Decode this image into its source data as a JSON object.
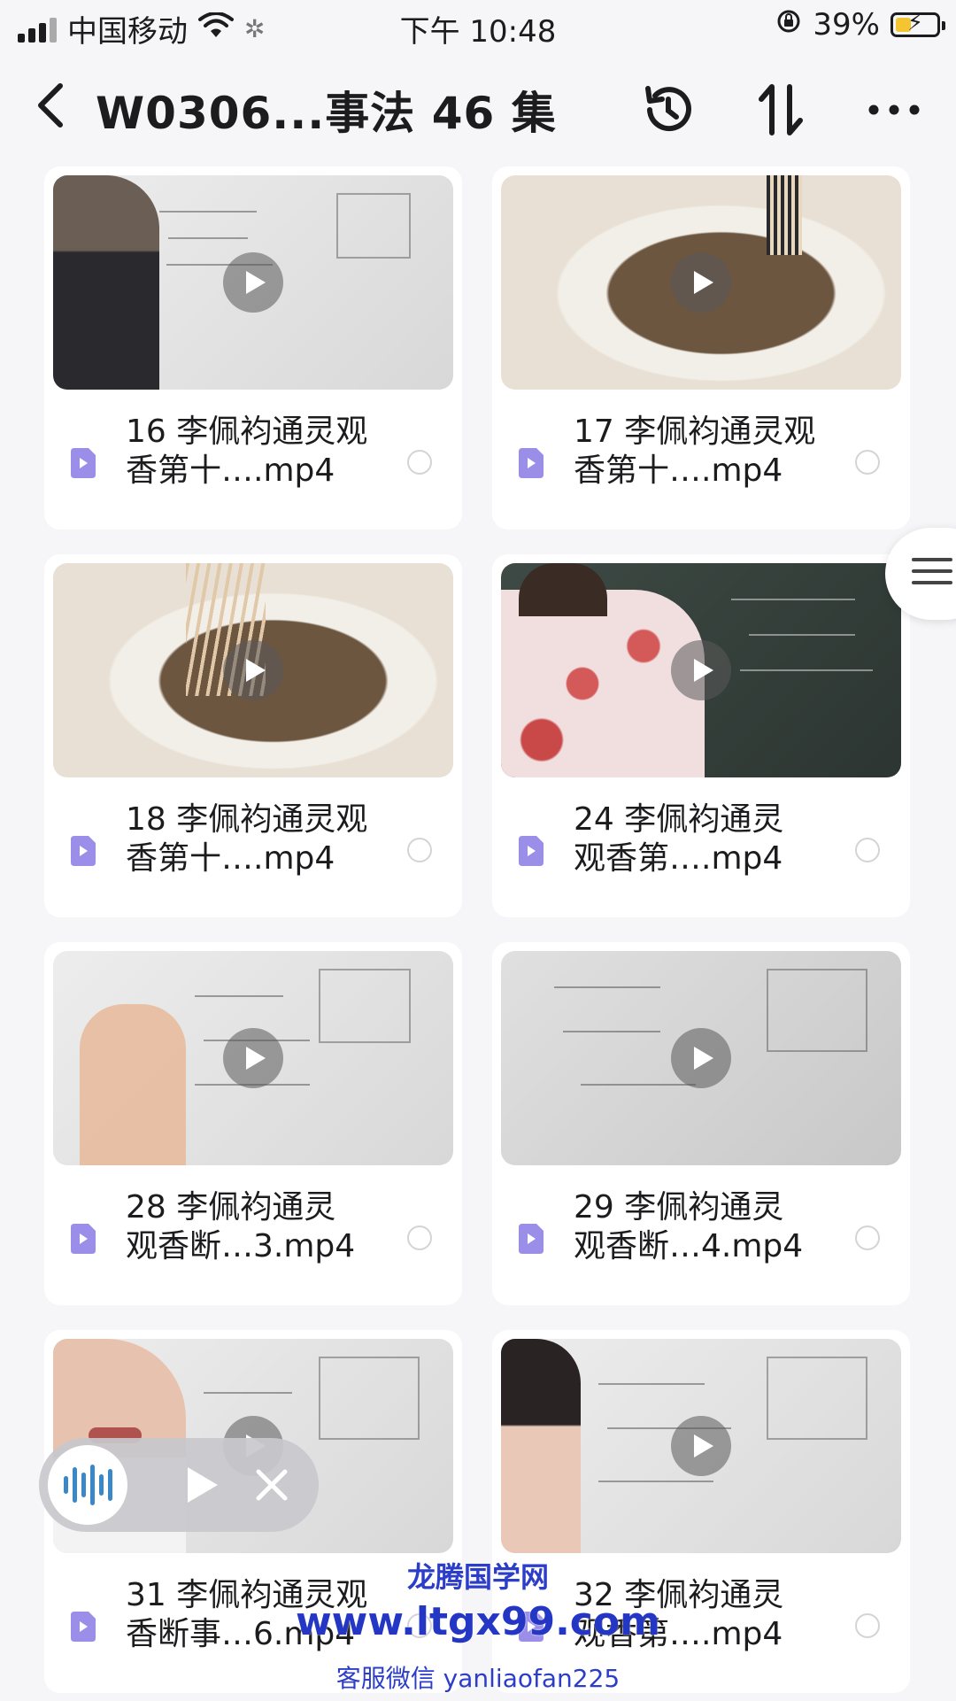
{
  "status_bar": {
    "carrier": "中国移动",
    "time": "下午 10:48",
    "battery_percent": "39%",
    "battery_level": 0.39,
    "accent": "#f3c530"
  },
  "nav": {
    "back_icon": "chevron-left-icon",
    "title": "W0306...事法 46 集",
    "icons": [
      "history-icon",
      "sort-icon",
      "more-icon"
    ]
  },
  "files": [
    {
      "name_line1": "16 李佩袀通灵观",
      "name_line2": "香第十….mp4"
    },
    {
      "name_line1": "17 李佩袀通灵观",
      "name_line2": "香第十….mp4"
    },
    {
      "name_line1": "18 李佩袀通灵观",
      "name_line2": "香第十….mp4"
    },
    {
      "name_line1": "24 李佩袀通灵",
      "name_line2": "观香第….mp4"
    },
    {
      "name_line1": "28 李佩袀通灵",
      "name_line2": "观香断…3.mp4"
    },
    {
      "name_line1": "29 李佩袀通灵",
      "name_line2": "观香断…4.mp4"
    },
    {
      "name_line1": "31 李佩袀通灵观",
      "name_line2": "香断事…6.mp4"
    },
    {
      "name_line1": "32 李佩袀通灵",
      "name_line2": "观香第….mp4"
    }
  ],
  "file_icon_color": "#9a8ee8",
  "watermark": {
    "line1": "龙腾国学网",
    "line2": "www.ltgx99.com",
    "line3": "客服微信 yanliaofan225"
  }
}
